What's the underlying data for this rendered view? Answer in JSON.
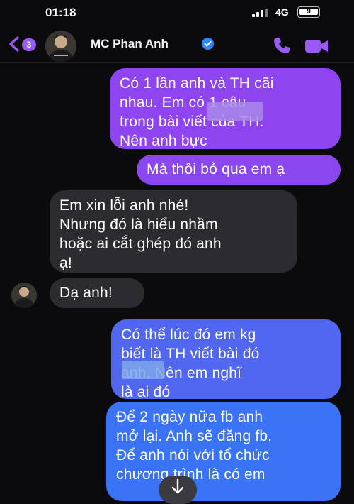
{
  "status_bar": {
    "time": "01:18",
    "network": "4G",
    "battery": "9"
  },
  "header": {
    "unread_count": "3",
    "contact_name": "MC Phan Anh",
    "back_icon": "chevron-left-icon",
    "call_icon": "phone-icon",
    "video_icon": "video-camera-icon"
  },
  "messages": [
    {
      "side": "outgoing",
      "text": "Có 1 lần anh và TH cãi\nnhau. Em có        1 câu\ntrong bài viết của TH.\nNên anh bực"
    },
    {
      "side": "outgoing",
      "text": "Mà thôi bỏ qua em ạ"
    },
    {
      "side": "incoming",
      "text": "Em xin lỗi anh nhé!\nNhưng đó là hiểu nhầm\nhoặc ai cắt ghép đó anh\nạ!"
    },
    {
      "side": "incoming",
      "text": "Dạ anh!"
    },
    {
      "side": "outgoing",
      "text": "Có thể lúc đó em kg\nbiết là TH viết bài đó\n            anh. Nên em nghĩ\nlà ai đó"
    },
    {
      "side": "outgoing",
      "text": "Để 2 ngày nữa fb anh\nmở lại.  Anh sẽ đăng fb.\nĐể anh nói với tổ chức\nchương trình là có em"
    }
  ],
  "colors": {
    "background": "#0b0b0d",
    "outgoing_purple": "#8e45f0",
    "outgoing_blue": "#3a73f5",
    "incoming": "#2c2c30",
    "badge": "#9b59f5",
    "verified": "#2f86f6"
  }
}
